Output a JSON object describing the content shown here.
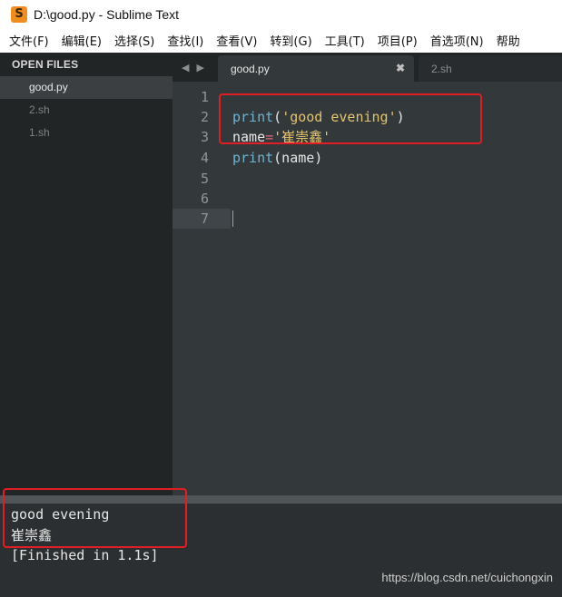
{
  "window": {
    "title": "D:\\good.py - Sublime Text",
    "logo_glyph": "S",
    "logo_color": "#f08d1d"
  },
  "menu": [
    {
      "label": "文件(F)"
    },
    {
      "label": "编辑(E)"
    },
    {
      "label": "选择(S)"
    },
    {
      "label": "查找(I)"
    },
    {
      "label": "查看(V)"
    },
    {
      "label": "转到(G)"
    },
    {
      "label": "工具(T)"
    },
    {
      "label": "项目(P)"
    },
    {
      "label": "首选项(N)"
    },
    {
      "label": "帮助"
    }
  ],
  "sidebar": {
    "header": "OPEN FILES",
    "files": [
      {
        "name": "good.py",
        "active": true
      },
      {
        "name": "2.sh",
        "active": false
      },
      {
        "name": "1.sh",
        "active": false
      }
    ]
  },
  "tabs": {
    "nav_left_icon": "◀",
    "nav_right_icon": "▶",
    "items": [
      {
        "label": "good.py",
        "active": true,
        "close_icon": "✖"
      },
      {
        "label": "2.sh",
        "active": false
      }
    ]
  },
  "editor": {
    "line_numbers": [
      "1",
      "2",
      "3",
      "4",
      "5",
      "6",
      "7"
    ],
    "code": {
      "line2": {
        "fn": "print",
        "open": "(",
        "str": "'good evening'",
        "close": ")"
      },
      "line3": {
        "var": "name",
        "op": "=",
        "str": "'崔崇鑫'"
      },
      "line4": {
        "fn": "print",
        "args": "(name)"
      }
    },
    "colors": {
      "background": "#33393b",
      "keyword": "#6fb3d2",
      "string": "#e4c46e",
      "operator": "#e3677a"
    }
  },
  "output": {
    "lines": [
      "good evening",
      "崔崇鑫",
      "[Finished in 1.1s]"
    ]
  },
  "annotation_color": "#e21d24",
  "watermark": "https://blog.csdn.net/cuichongxin"
}
